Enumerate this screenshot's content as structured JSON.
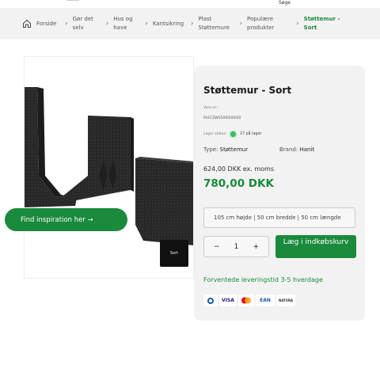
{
  "header": {
    "search_label": "Søge"
  },
  "breadcrumb": {
    "items": [
      {
        "label": "Forside"
      },
      {
        "label": "Gør det selv"
      },
      {
        "label": "Hus og have"
      },
      {
        "label": "Kantsikring"
      },
      {
        "label": "Plast Støttemure"
      },
      {
        "label": "Populære produkter"
      },
      {
        "label": "Støttemur - Sort"
      }
    ]
  },
  "gallery": {
    "thumb_label": "Sort",
    "inspiration_button": "Find inspiration her →"
  },
  "product": {
    "title": "Støttemur - Sort",
    "sku_label": "Vare nr.:",
    "sku": "PLECZWS500500050",
    "stock_label": "Lager status:",
    "stock_text": "17 på lager",
    "type_label": "Type:",
    "type_value": "Støttemur",
    "brand_label": "Brand:",
    "brand_value": "Hanit",
    "price_ex": "624,00 DKK ex. moms",
    "price": "780,00 DKK",
    "variant_selected": "105 cm højde | 50 cm bredde | 50 cm længde",
    "quantity": "1",
    "qty_minus": "−",
    "qty_plus": "+",
    "cart_button": "Læg i indkøbskurv",
    "delivery": "Forventede leveringstid 3-5 hverdage",
    "payment_methods": [
      "VISA",
      "EAN",
      "NATURA"
    ]
  },
  "colors": {
    "accent": "#1a8a3c",
    "panel_bg": "#f2f2f2",
    "breadcrumb_bg": "#f2f2f2"
  }
}
